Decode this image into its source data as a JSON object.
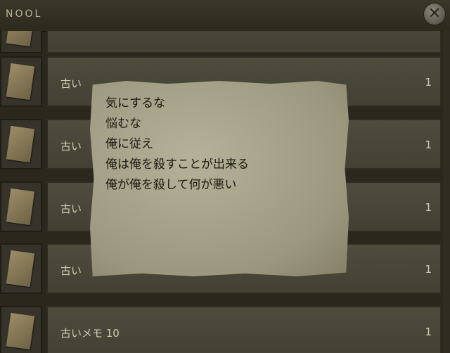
{
  "window": {
    "title": "NOOL",
    "close_icon": "✕"
  },
  "items": [
    {
      "name": "",
      "qty": ""
    },
    {
      "name": "古い",
      "qty": "1"
    },
    {
      "name": "古い",
      "qty": "1"
    },
    {
      "name": "古い",
      "qty": "1"
    },
    {
      "name": "古い",
      "qty": "1"
    },
    {
      "name": "古いメモ 10",
      "qty": "1"
    }
  ],
  "note": {
    "lines": [
      "気にするな",
      "悩むな",
      "俺に従え",
      "俺は俺を殺すことが出来る",
      "俺が俺を殺して何が悪い"
    ]
  },
  "colors": {
    "background": "#2a281c",
    "paper": "#b0ab93",
    "text": "#cfcab2"
  }
}
